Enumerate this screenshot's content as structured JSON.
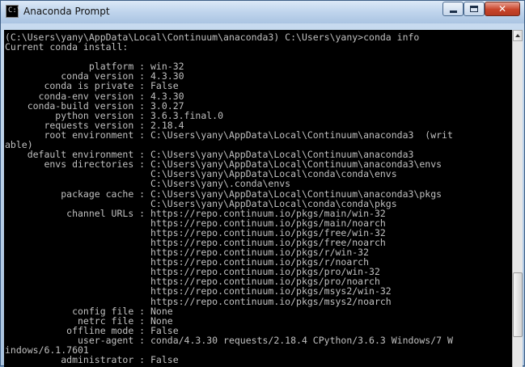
{
  "window": {
    "title": "Anaconda Prompt",
    "icon_name": "cmd-console-icon",
    "icon_text": "C:\\",
    "controls": {
      "minimize": "minimize-icon",
      "maximize": "maximize-icon",
      "close": "close-icon"
    }
  },
  "console": {
    "background": "#000000",
    "foreground": "#c0c0c0",
    "lines": [
      "(C:\\Users\\yany\\AppData\\Local\\Continuum\\anaconda3) C:\\Users\\yany>conda info",
      "Current conda install:",
      "",
      "               platform : win-32",
      "          conda version : 4.3.30",
      "       conda is private : False",
      "      conda-env version : 4.3.30",
      "    conda-build version : 3.0.27",
      "         python version : 3.6.3.final.0",
      "       requests version : 2.18.4",
      "       root environment : C:\\Users\\yany\\AppData\\Local\\Continuum\\anaconda3  (writ",
      "able)",
      "    default environment : C:\\Users\\yany\\AppData\\Local\\Continuum\\anaconda3",
      "       envs directories : C:\\Users\\yany\\AppData\\Local\\Continuum\\anaconda3\\envs",
      "                          C:\\Users\\yany\\AppData\\Local\\conda\\conda\\envs",
      "                          C:\\Users\\yany\\.conda\\envs",
      "          package cache : C:\\Users\\yany\\AppData\\Local\\Continuum\\anaconda3\\pkgs",
      "                          C:\\Users\\yany\\AppData\\Local\\conda\\conda\\pkgs",
      "           channel URLs : https://repo.continuum.io/pkgs/main/win-32",
      "                          https://repo.continuum.io/pkgs/main/noarch",
      "                          https://repo.continuum.io/pkgs/free/win-32",
      "                          https://repo.continuum.io/pkgs/free/noarch",
      "                          https://repo.continuum.io/pkgs/r/win-32",
      "                          https://repo.continuum.io/pkgs/r/noarch",
      "                          https://repo.continuum.io/pkgs/pro/win-32",
      "                          https://repo.continuum.io/pkgs/pro/noarch",
      "                          https://repo.continuum.io/pkgs/msys2/win-32",
      "                          https://repo.continuum.io/pkgs/msys2/noarch",
      "            config file : None",
      "             netrc file : None",
      "           offline mode : False",
      "             user-agent : conda/4.3.30 requests/2.18.4 CPython/3.6.3 Windows/7 W",
      "indows/6.1.7601",
      "          administrator : False"
    ]
  },
  "scrollbar": {
    "up_arrow": "arrow-up-icon"
  }
}
